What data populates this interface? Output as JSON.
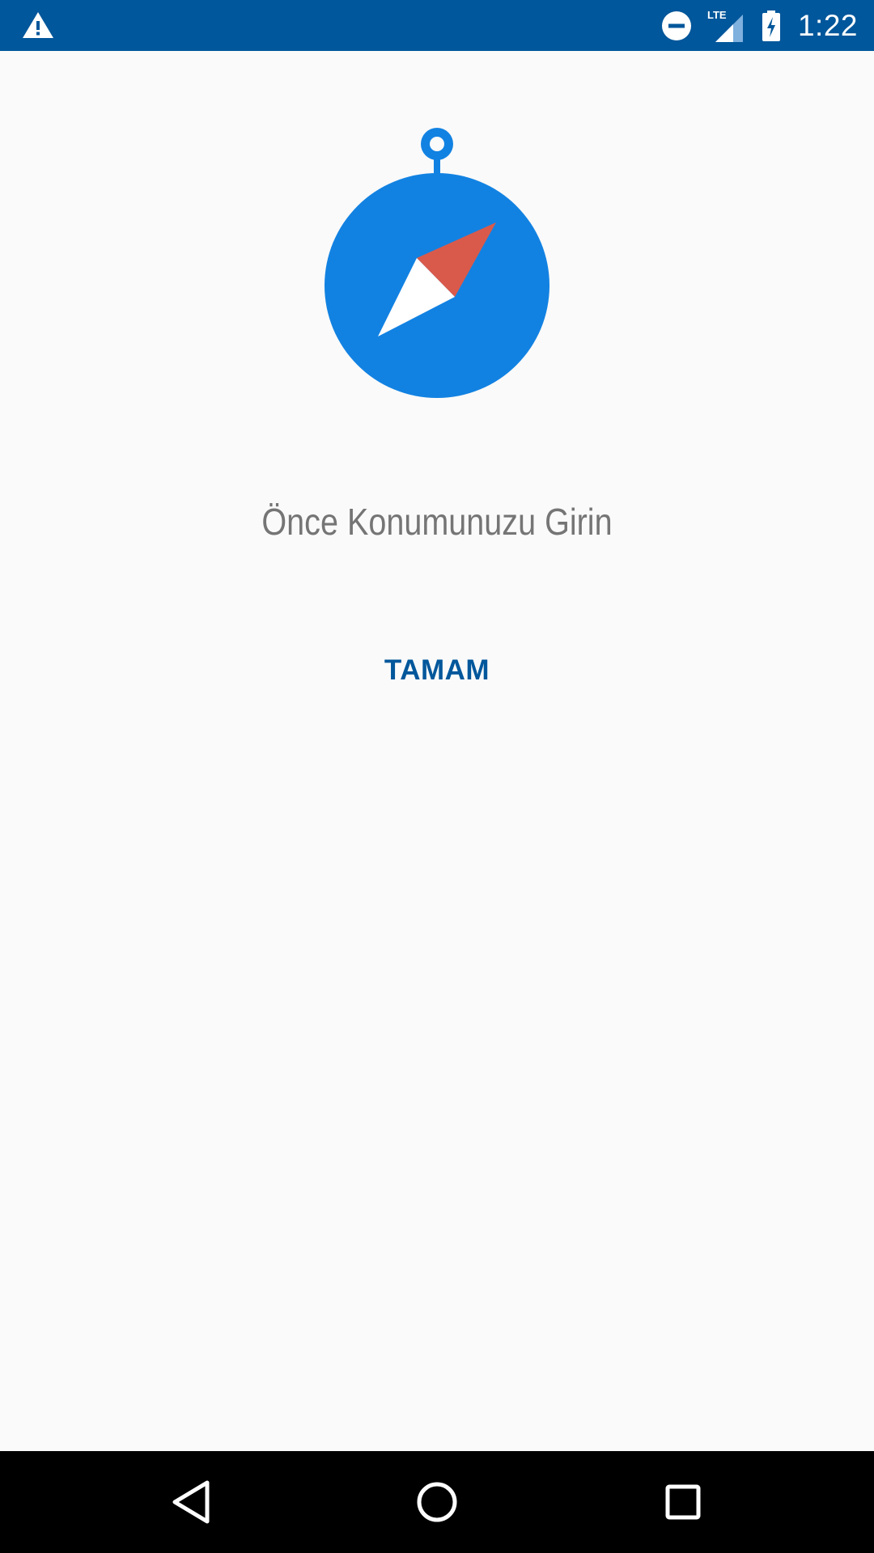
{
  "status_bar": {
    "time": "1:22",
    "network_label": "LTE",
    "background_color": "#01579b",
    "icons": [
      "warning-icon",
      "do-not-disturb-icon",
      "lte-signal-icon",
      "battery-charging-icon"
    ]
  },
  "main": {
    "illustration_icon": "compass-icon",
    "message": "Önce Konumunuzu Girin",
    "ok_button_label": "TAMAM",
    "accent_color": "#01579b",
    "compass_color": "#1282e2",
    "needle_color": "#d95a4b"
  },
  "nav_bar": {
    "icons": [
      "back-icon",
      "home-icon",
      "recents-icon"
    ]
  }
}
